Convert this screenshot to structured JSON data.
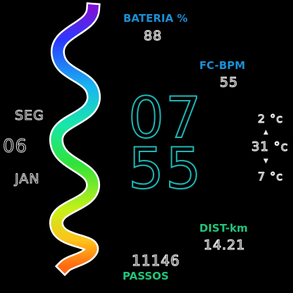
{
  "battery": {
    "label": "BATERIA %",
    "value": "88"
  },
  "heart_rate": {
    "label": "FC-BPM",
    "value": "55"
  },
  "clock": {
    "hours": "07",
    "minutes": "55"
  },
  "date": {
    "weekday": "SEG",
    "day": "06",
    "month": "JAN"
  },
  "weather": {
    "low": "2 °c",
    "up_arrow": "▲",
    "current": "31 °c",
    "down_arrow": "▼",
    "high": "7 °c"
  },
  "distance": {
    "label": "DIST-km",
    "value": "14.21"
  },
  "steps": {
    "value": "11146",
    "label": "PASSOS"
  },
  "colors": {
    "blue_label": "#1a8fd6",
    "green_label": "#22c37a",
    "clock_stroke": "#1fb5b5"
  }
}
